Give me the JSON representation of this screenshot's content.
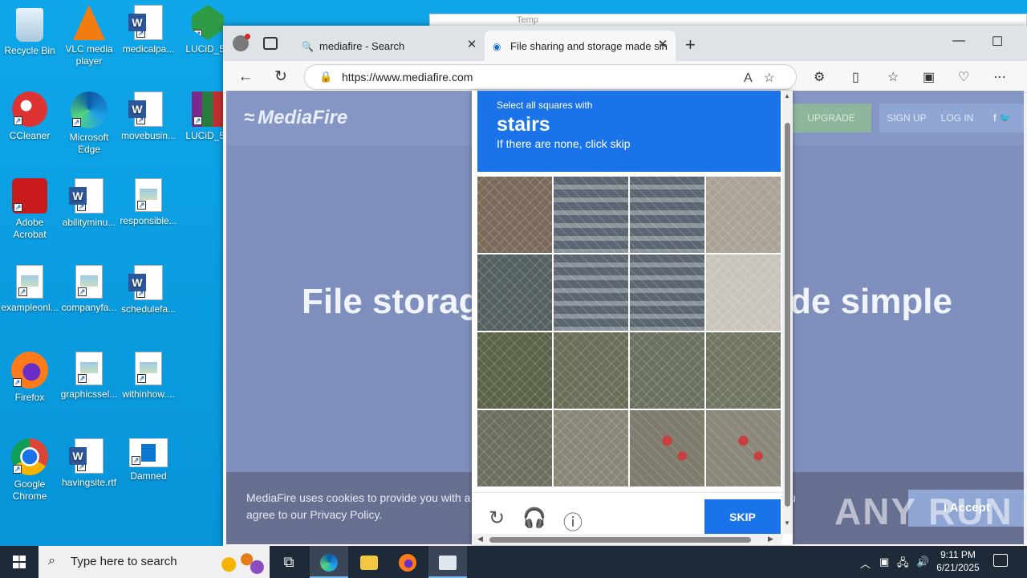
{
  "desktop": {
    "icons": [
      {
        "label": "Recycle Bin",
        "icon": "recycle-bin-icon"
      },
      {
        "label": "VLC media player",
        "icon": "vlc-icon"
      },
      {
        "label": "medicalpa...",
        "icon": "word-doc-icon"
      },
      {
        "label": "LUCiD_5e",
        "icon": "gem-icon"
      },
      {
        "label": "CCleaner",
        "icon": "ccleaner-icon"
      },
      {
        "label": "Microsoft Edge",
        "icon": "edge-icon"
      },
      {
        "label": "movebusin...",
        "icon": "word-doc-icon"
      },
      {
        "label": "LUCiD_5e",
        "icon": "winrar-icon"
      },
      {
        "label": "Adobe Acrobat",
        "icon": "acrobat-icon"
      },
      {
        "label": "abilityminu...",
        "icon": "word-doc-icon"
      },
      {
        "label": "responsible...",
        "icon": "image-file-icon"
      },
      {
        "label": "exampleonl...",
        "icon": "image-file-icon"
      },
      {
        "label": "companyfa...",
        "icon": "image-file-icon"
      },
      {
        "label": "schedulefa...",
        "icon": "word-doc-icon"
      },
      {
        "label": "Firefox",
        "icon": "firefox-icon"
      },
      {
        "label": "graphicssel...",
        "icon": "image-file-icon"
      },
      {
        "label": "withinhow....",
        "icon": "image-file-icon"
      },
      {
        "label": "Google Chrome",
        "icon": "chrome-icon"
      },
      {
        "label": "havingsite.rtf",
        "icon": "word-doc-icon"
      },
      {
        "label": "Damned",
        "icon": "damned-icon"
      }
    ],
    "background_window_text": "Temp"
  },
  "browser": {
    "tabs": [
      {
        "title": "mediafire - Search",
        "icon": "search-icon",
        "active": false
      },
      {
        "title": "File sharing and storage made sin",
        "icon": "mediafire-icon",
        "active": true
      }
    ],
    "new_tab_label": "+",
    "address": "https://www.mediafire.com",
    "window_controls": {
      "minimize": "—",
      "maximize": "☐"
    }
  },
  "page": {
    "logo": "MediaFire",
    "nav": {
      "upgrade": "UPGRADE",
      "signup": "SIGN UP",
      "login": "LOG IN",
      "social": "f  🐦"
    },
    "hero_left": "File storag",
    "hero_right": "de simple",
    "cookie_line1": "MediaFire uses cookies to provide you with a p",
    "cookie_line1_tail": "u",
    "cookie_line2": "agree to our Privacy Policy.",
    "accept_label": "I Accept"
  },
  "captcha": {
    "instruction": "Select all squares with",
    "target": "stairs",
    "hint": "If there are none, click skip",
    "skip_label": "SKIP",
    "tiles": 16,
    "footer_icons": [
      "refresh-icon",
      "audio-icon",
      "info-icon"
    ],
    "accent": "#1a73e8"
  },
  "watermark": "ANY RUN",
  "taskbar": {
    "search_placeholder": "Type here to search",
    "apps": [
      "task-view-icon",
      "edge-icon",
      "file-explorer-icon",
      "firefox-icon",
      "app-window-icon"
    ],
    "time": "9:11 PM",
    "date": "6/21/2025"
  }
}
